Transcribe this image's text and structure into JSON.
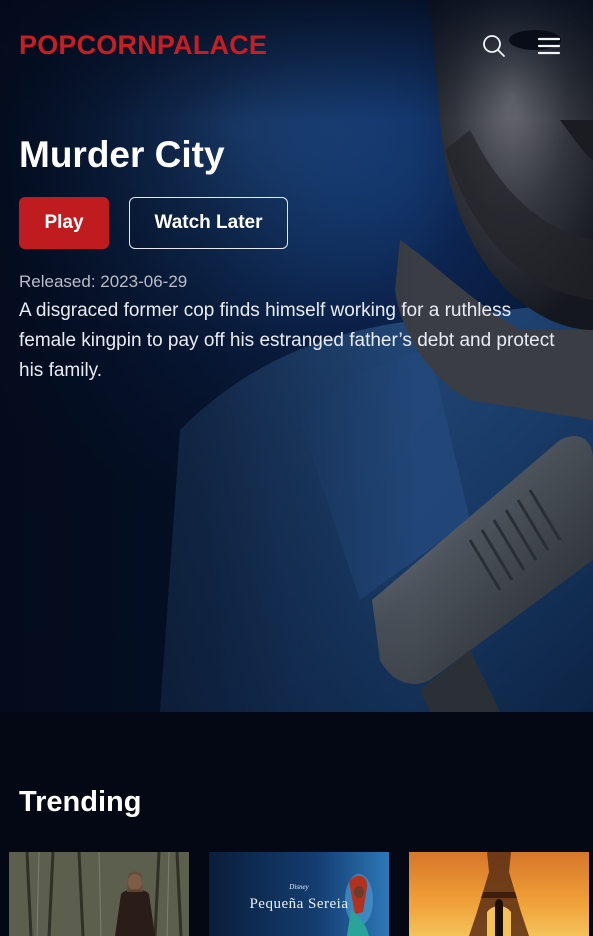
{
  "header": {
    "logo": "POPCORNPALACE",
    "search_icon": "search-icon",
    "menu_icon": "hamburger-menu-icon"
  },
  "hero": {
    "title": "Murder City",
    "play_label": "Play",
    "watch_later_label": "Watch Later",
    "released": "Released: 2023-06-29",
    "description": "A disgraced former cop finds himself working for a ruthless female kingpin to pay off his estranged father’s debt and protect his family."
  },
  "trending": {
    "title": "Trending",
    "cards": [
      {
        "name": "forest-movie-card"
      },
      {
        "name": "little-mermaid-card",
        "studio": "Disney",
        "title_text": "Pequeña Sereia"
      },
      {
        "name": "eiffel-tower-movie-card"
      }
    ]
  },
  "colors": {
    "brand": "#c81e22",
    "play_button": "#c01c20",
    "background": "#030814"
  }
}
